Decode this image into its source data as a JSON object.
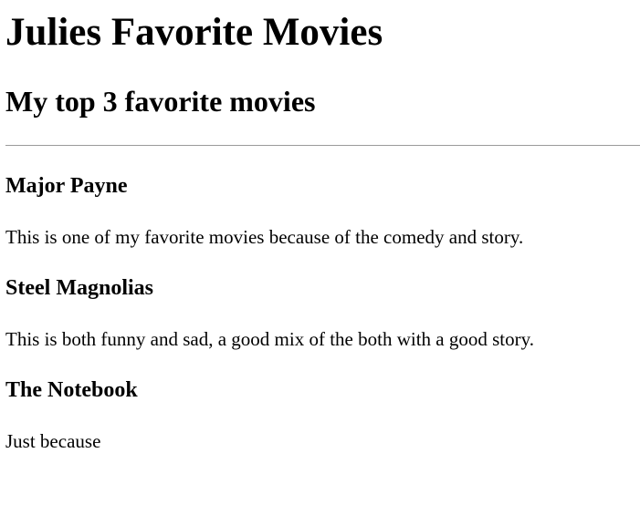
{
  "page": {
    "title": "Julies Favorite Movies",
    "subtitle": "My top 3 favorite movies"
  },
  "movies": [
    {
      "title": "Major Payne",
      "description": "This is one of my favorite movies because of the comedy and story."
    },
    {
      "title": "Steel Magnolias",
      "description": "This is both funny and sad, a good mix of the both with a good story."
    },
    {
      "title": "The Notebook",
      "description": "Just because"
    }
  ],
  "colors": {
    "text": "#000000",
    "background": "#ffffff",
    "divider": "#9a9a9a"
  }
}
